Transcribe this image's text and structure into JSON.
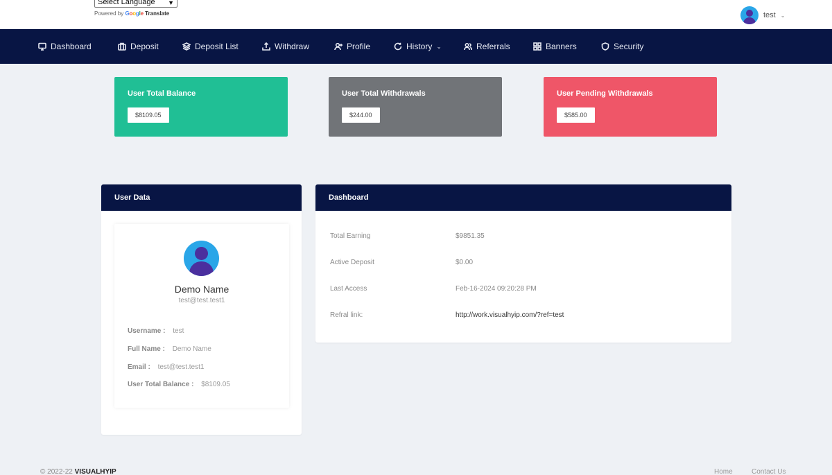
{
  "header": {
    "language_select": "Select Language",
    "powered_by": "Powered by",
    "google": "Google",
    "translate": "Translate",
    "user_name": "test"
  },
  "nav": {
    "dashboard": "Dashboard",
    "deposit": "Deposit",
    "deposit_list": "Deposit List",
    "withdraw": "Withdraw",
    "profile": "Profile",
    "history": "History",
    "referrals": "Referrals",
    "banners": "Banners",
    "security": "Security"
  },
  "stats": {
    "balance_title": "User Total Balance",
    "balance_value": "$8109.05",
    "withdrawals_title": "User Total Withdrawals",
    "withdrawals_value": "$244.00",
    "pending_title": "User Pending Withdrawals",
    "pending_value": "$585.00"
  },
  "user_panel": {
    "title": "User Data",
    "name": "Demo Name",
    "email": "test@test.test1",
    "username_label": "Username :",
    "username_value": "test",
    "fullname_label": "Full Name :",
    "fullname_value": "Demo Name",
    "email_label": "Email :",
    "email_value": "test@test.test1",
    "balance_label": "User Total Balance :",
    "balance_value": "$8109.05"
  },
  "dashboard_panel": {
    "title": "Dashboard",
    "total_earning_label": "Total Earning",
    "total_earning_value": "$9851.35",
    "active_deposit_label": "Active Deposit",
    "active_deposit_value": "$0.00",
    "last_access_label": "Last Access",
    "last_access_value": "Feb-16-2024 09:20:28 PM",
    "ref_link_label": "Refral link:",
    "ref_link_value": "http://work.visualhyip.com/?ref=test"
  },
  "footer": {
    "copyright": "© 2022-22",
    "brand": "VISUALHYIP",
    "home": "Home",
    "contact": "Contact Us"
  },
  "colors": {
    "navy": "#081544",
    "green": "#20bf95",
    "gray": "#717478",
    "red": "#ef5668",
    "avatar_blue": "#2aa6e8",
    "avatar_purple": "#4b2f9e"
  }
}
